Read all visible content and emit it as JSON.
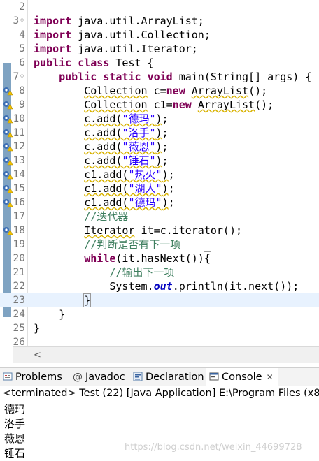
{
  "editor": {
    "lines": [
      {
        "num": "2",
        "html": ""
      },
      {
        "num": "3◦",
        "html": "<span class='kw'>import</span> java.util.ArrayList;"
      },
      {
        "num": "4",
        "html": "<span class='kw'>import</span> java.util.Collection;"
      },
      {
        "num": "5",
        "html": "<span class='kw'>import</span> java.util.Iterator;"
      },
      {
        "num": "6",
        "html": "<span class='kw'>public</span> <span class='kw'>class</span> Test {"
      },
      {
        "num": "7◦",
        "html": "    <span class='kw'>public</span> <span class='kw'>static</span> <span class='kw'>void</span> main(String[] args) {"
      },
      {
        "num": "8",
        "html": "        <span class='warn'>Collection</span> c=<span class='kw'>new</span> <span class='warn'>ArrayList</span>();"
      },
      {
        "num": "9",
        "html": "        <span class='warn'>Collection</span> c1=<span class='kw'>new</span> <span class='warn'>ArrayList</span>();"
      },
      {
        "num": "10",
        "html": "        <span class='warn'>c.add(<span class='str'>\"德玛\"</span>)</span>;"
      },
      {
        "num": "11",
        "html": "        <span class='warn'>c.add(<span class='str'>\"洛手\"</span>)</span>;"
      },
      {
        "num": "12",
        "html": "        <span class='warn'>c.add(<span class='str'>\"薇恩\"</span>)</span>;"
      },
      {
        "num": "13",
        "html": "        <span class='warn'>c.add(<span class='str'>\"锤石\"</span>)</span>;"
      },
      {
        "num": "14",
        "html": "        <span class='warn'>c1.add(<span class='str'>\"热火\"</span>)</span>;"
      },
      {
        "num": "15",
        "html": "        <span class='warn'>c1.add(<span class='str'>\"湖人\"</span>)</span>;"
      },
      {
        "num": "16",
        "html": "        <span class='warn'>c1.add(<span class='str'>\"德玛\"</span>)</span>;"
      },
      {
        "num": "17",
        "html": "        <span class='cmt'>//迭代器</span>"
      },
      {
        "num": "18",
        "html": "        <span class='warn'>Iterator</span> it=c.iterator();"
      },
      {
        "num": "19",
        "html": "        <span class='cmt'>//判断是否有下一项</span>"
      },
      {
        "num": "20",
        "html": "        <span class='kw'>while</span>(it.hasNext())<span class='bracket-box'>{</span>"
      },
      {
        "num": "21",
        "html": "            <span class='cmt'>//输出下一项</span>"
      },
      {
        "num": "22",
        "html": "            System.<span class='fld'>out</span>.println(it.next());"
      },
      {
        "num": "23",
        "html": "        <span class='bracket-box'>}</span><span class='caret'></span>"
      },
      {
        "num": "24",
        "html": "    }"
      },
      {
        "num": "25",
        "html": "}"
      },
      {
        "num": "26",
        "html": ""
      }
    ]
  },
  "tabs": [
    {
      "label": "Problems",
      "icon": "problems-icon"
    },
    {
      "label": "Javadoc",
      "icon": "at-icon"
    },
    {
      "label": "Declaration",
      "icon": "declaration-icon"
    },
    {
      "label": "Console",
      "icon": "console-icon",
      "active": true
    }
  ],
  "console": {
    "title": "<terminated> Test (22) [Java Application] E:\\Program Files (x86",
    "output": [
      "德玛",
      "洛手",
      "薇恩",
      "锤石"
    ],
    "watermark": "https://blog.csdn.net/weixin_44699728"
  },
  "colors": {
    "keyword": "#7f0055",
    "string": "#2a00ff",
    "comment": "#3f7f5f",
    "field": "#0000c0"
  }
}
